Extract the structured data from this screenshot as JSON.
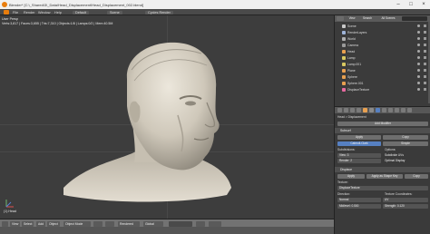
{
  "window": {
    "title": "Blender* [C:\\_Shared\\3\\_Data\\Head_Displacement\\Head_Displacement_002.blend]"
  },
  "menubar": {
    "items": [
      "File",
      "Render",
      "Window",
      "Help"
    ],
    "layout": "Default",
    "scene": "Scene",
    "engine": "Cycles Render"
  },
  "viewport": {
    "info_line": "User Persp",
    "stats_line": "Verts:3,817 | Faces:3,655 | Tris:7,310 | Objects:1/8 | Lamps:0/2 | Mem:40.5M",
    "object_name": "(1) Head"
  },
  "bottom_toolbar": {
    "view": "View",
    "select": "Select",
    "add": "Add",
    "object": "Object",
    "mode": "Object Mode",
    "shading": "Rendered",
    "pivot": "Global",
    "layer_info": "1"
  },
  "outliner": {
    "header_view": "View",
    "header_search": "Search",
    "header_scope": "All Scenes",
    "rows": [
      {
        "label": "Scene",
        "color": "#c8c8c8"
      },
      {
        "label": "RenderLayers",
        "color": "#9fb4d8"
      },
      {
        "label": "World",
        "color": "#b0b0b0"
      },
      {
        "label": "Camera",
        "color": "#9a9a9a"
      },
      {
        "label": "Head",
        "color": "#e8a050"
      },
      {
        "label": "Lamp",
        "color": "#d8c860"
      },
      {
        "label": "Lamp.001",
        "color": "#d8c860"
      },
      {
        "label": "Plane",
        "color": "#e8a050"
      },
      {
        "label": "Sphere",
        "color": "#e8a050"
      },
      {
        "label": "Sphere.001",
        "color": "#e8a050"
      },
      {
        "label": "DisplaceTexture",
        "color": "#e86aa0"
      }
    ]
  },
  "properties": {
    "breadcrumb": "Head > Displacement",
    "add_modifier": "Add Modifier",
    "modifier_1": {
      "name": "Subsurf",
      "apply": "Apply",
      "copy": "Copy",
      "tab_catmull": "Catmull-Clark",
      "tab_simple": "Simple",
      "subdiv_label": "Subdivisions:",
      "view_label": "View:",
      "view_value": "3",
      "render_label": "Render:",
      "render_value": "2",
      "options_label": "Options:",
      "opt_smooth": "Subdivide UVs",
      "opt_optimal": "Optimal Display"
    },
    "modifier_2": {
      "name": "Displace",
      "apply": "Apply",
      "apply_shape": "Apply as Shape Key",
      "copy": "Copy",
      "texture_label": "Texture:",
      "texture_value": "DisplaceTexture",
      "direction_label": "Direction:",
      "direction_value": "Normal",
      "coords_label": "Texture Coordinates:",
      "coords_value": "UV",
      "midlevel_label": "Midlevel:",
      "midlevel_value": "0.500",
      "strength_label": "Strength:",
      "strength_value": "0.120"
    }
  },
  "colors": {
    "accent_blue": "#5680c2",
    "viewport_bg": "#3d3d3d",
    "head_skin": "#d9d3c6"
  }
}
